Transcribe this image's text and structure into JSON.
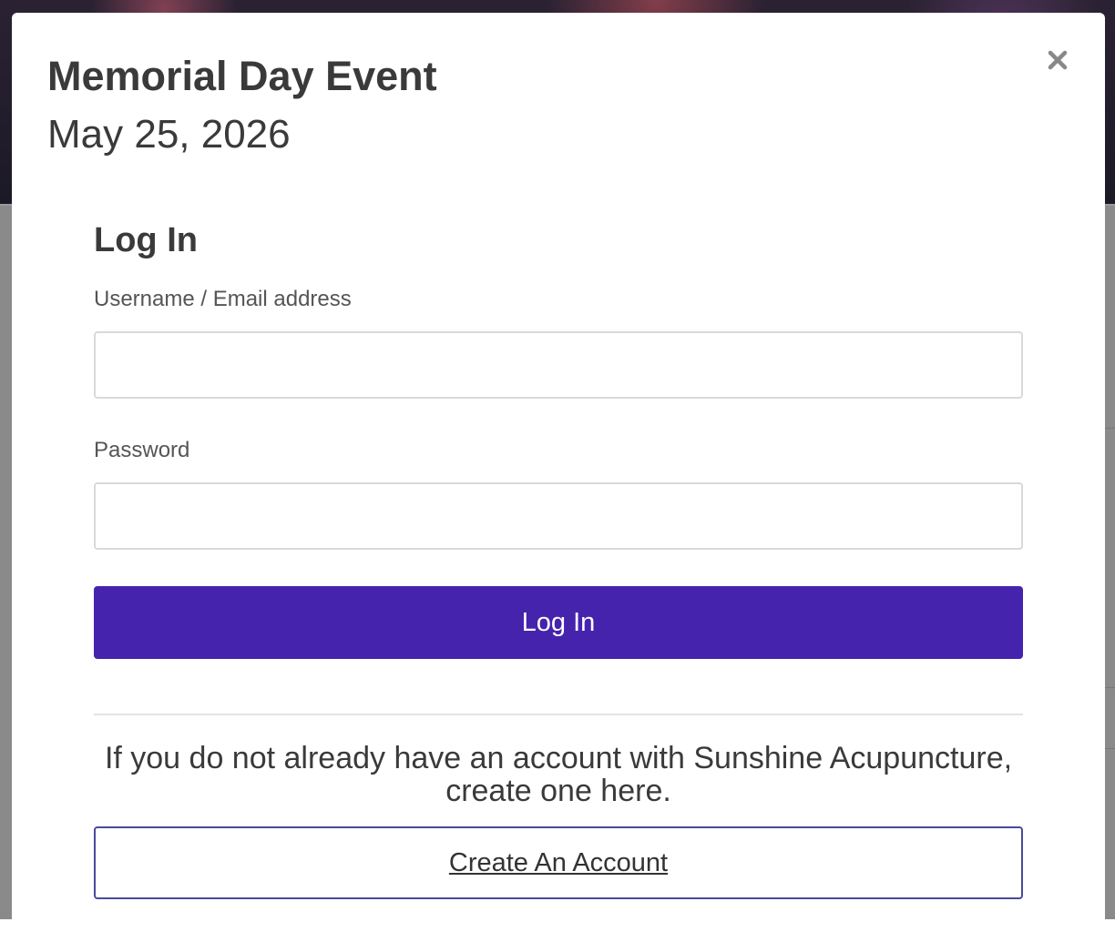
{
  "modal": {
    "event_title": "Memorial Day Event",
    "event_date": "May 25, 2026",
    "close_icon": "close-icon"
  },
  "login": {
    "heading": "Log In",
    "username_label": "Username / Email address",
    "username_value": "",
    "password_label": "Password",
    "password_value": "",
    "submit_label": "Log In"
  },
  "signup": {
    "prompt": "If you do not already have an account with Sunshine Acupuncture, create one here.",
    "button_label": "Create An Account"
  },
  "colors": {
    "primary": "#4623ad",
    "outline": "#4a4a9a",
    "text": "#3a3a3a"
  }
}
